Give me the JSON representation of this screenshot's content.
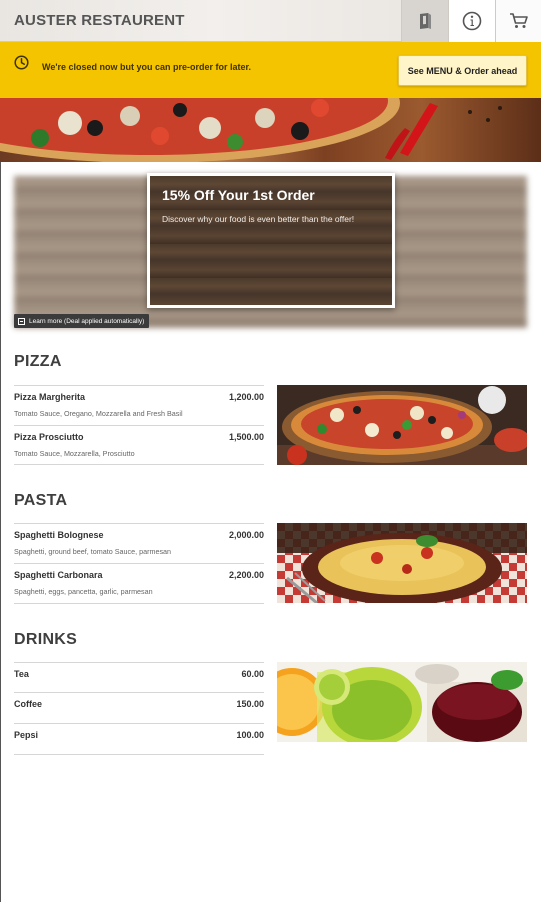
{
  "header": {
    "title": "AUSTER RESTAURENT",
    "icons": [
      "menu-book-icon",
      "info-icon",
      "cart-icon"
    ]
  },
  "notice": {
    "message": "We're closed now but you can pre-order for later.",
    "button_label": "See MENU & Order ahead",
    "icon": "clock-icon"
  },
  "promo": {
    "title": "15% Off Your 1st Order",
    "subtitle": "Discover why our food is even better than the offer!",
    "learn_more": "Learn more (Deal applied automatically)"
  },
  "sections": [
    {
      "title": "PIZZA",
      "items": [
        {
          "name": "Pizza Margherita",
          "price": "1,200.00",
          "desc": "Tomato Sauce, Oregano, Mozzarella and Fresh Basil"
        },
        {
          "name": "Pizza Prosciutto",
          "price": "1,500.00",
          "desc": "Tomato Sauce, Mozzarella, Prosciutto"
        }
      ]
    },
    {
      "title": "PASTA",
      "items": [
        {
          "name": "Spaghetti Bolognese",
          "price": "2,000.00",
          "desc": "Spaghetti, ground beef, tomato Sauce, parmesan"
        },
        {
          "name": "Spaghetti Carbonara",
          "price": "2,200.00",
          "desc": "Spaghetti, eggs, pancetta, garlic, parmesan"
        }
      ]
    },
    {
      "title": "DRINKS",
      "items": [
        {
          "name": "Tea",
          "price": "60.00"
        },
        {
          "name": "Coffee",
          "price": "150.00"
        },
        {
          "name": "Pepsi",
          "price": "100.00"
        }
      ]
    }
  ],
  "colors": {
    "notice_bg": "#f5c400",
    "button_bg": "#fff5c9",
    "title_text": "#3f3f3f"
  }
}
